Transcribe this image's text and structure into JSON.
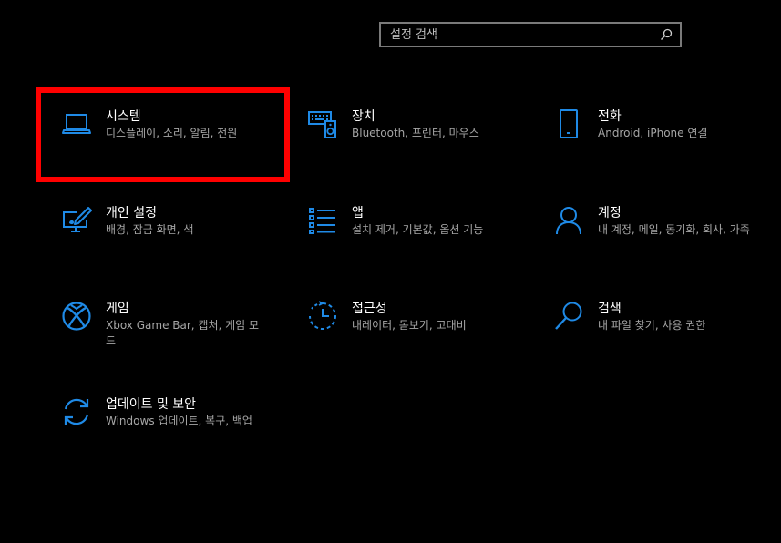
{
  "search": {
    "placeholder": "설정 검색"
  },
  "accent_color": "#1f8ae6",
  "highlight_color": "#ff0000",
  "tiles": [
    {
      "title": "시스템",
      "desc": "디스플레이, 소리, 알림, 전원",
      "icon": "laptop-icon"
    },
    {
      "title": "장치",
      "desc": "Bluetooth, 프린터, 마우스",
      "icon": "keyboard-speaker-icon"
    },
    {
      "title": "전화",
      "desc": "Android, iPhone 연결",
      "icon": "phone-icon"
    },
    {
      "title": "개인 설정",
      "desc": "배경, 잠금 화면, 색",
      "icon": "paint-monitor-icon"
    },
    {
      "title": "앱",
      "desc": "설치 제거, 기본값, 옵션 기능",
      "icon": "app-list-icon"
    },
    {
      "title": "계정",
      "desc": "내 계정, 메일, 동기화, 회사, 가족",
      "icon": "person-icon"
    },
    {
      "title": "게임",
      "desc": "Xbox Game Bar, 캡처, 게임 모드",
      "icon": "xbox-icon"
    },
    {
      "title": "접근성",
      "desc": "내레이터, 돋보기, 고대비",
      "icon": "ease-of-access-icon"
    },
    {
      "title": "검색",
      "desc": "내 파일 찾기, 사용 권한",
      "icon": "magnifier-icon"
    },
    {
      "title": "업데이트 및 보안",
      "desc": "Windows 업데이트, 복구, 백업",
      "icon": "sync-arrows-icon"
    }
  ]
}
